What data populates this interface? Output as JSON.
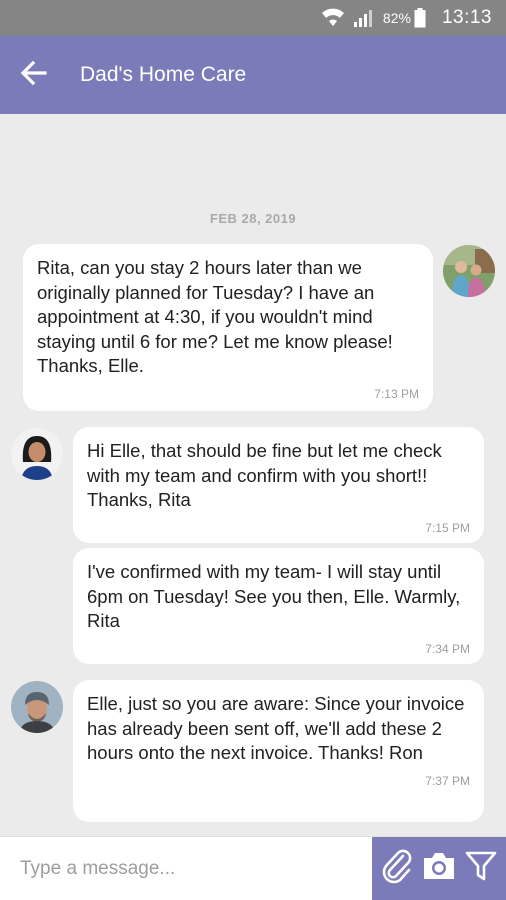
{
  "status_bar": {
    "battery": "82%",
    "time": "13:13",
    "icons": [
      "wifi-icon",
      "signal-icon",
      "battery-icon"
    ]
  },
  "header": {
    "title": "Dad's Home Care",
    "back_icon": "arrow-left-icon"
  },
  "chat": {
    "date_separator": "FEB 28, 2019",
    "messages": [
      {
        "sender_side": "right",
        "avatar": "avatar-elle",
        "text": "Rita, can you stay 2 hours later than we originally planned for Tuesday? I have an appointment at 4:30, if you wouldn't mind staying until 6 for me? Let me know please! Thanks, Elle.",
        "time": "7:13 PM"
      },
      {
        "sender_side": "left",
        "avatar": "avatar-rita",
        "text": "Hi Elle, that should be fine but let me check with my team and confirm with you short!! Thanks, Rita",
        "time": "7:15 PM"
      },
      {
        "sender_side": "left",
        "avatar": "",
        "text": "I've confirmed with my team- I will stay until 6pm on Tuesday! See you then, Elle. Warmly, Rita",
        "time": "7:34 PM"
      },
      {
        "sender_side": "left",
        "avatar": "avatar-ron",
        "text": "Elle, just so you are aware: Since your invoice has already been sent off, we'll add these 2 hours onto the next invoice. Thanks! Ron",
        "time": "7:37 PM"
      }
    ]
  },
  "composer": {
    "placeholder": "Type a message...",
    "value": "",
    "actions": [
      "paperclip-icon",
      "camera-icon",
      "filter-icon"
    ]
  },
  "colors": {
    "accent": "#7b7bb9",
    "status_bar": "#858585",
    "chat_background": "#ebebeb",
    "bubble": "#ffffff"
  }
}
